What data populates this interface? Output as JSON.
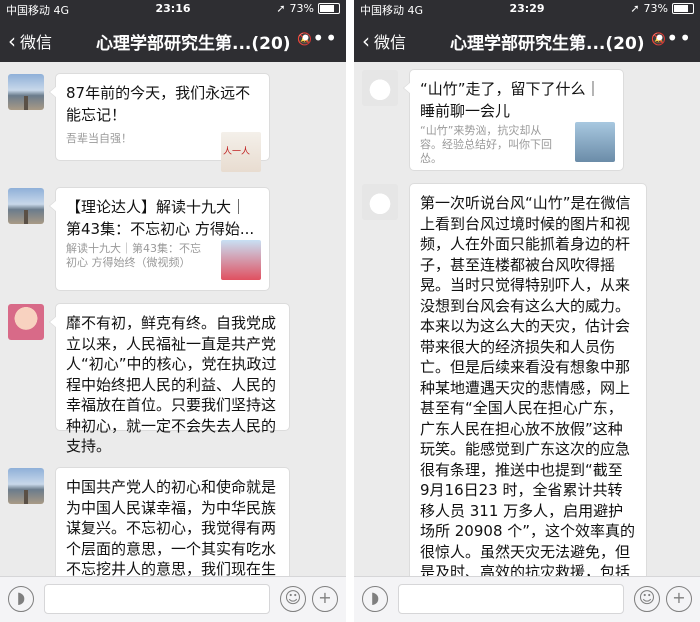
{
  "left": {
    "status": {
      "carrier": "中国移动  4G",
      "time": "23:16",
      "battery": "73%"
    },
    "nav": {
      "back": "微信",
      "title": "心理学部研究生第...(20)"
    },
    "messages": [
      {
        "type": "link",
        "title": "87年前的今天，我们永远不能忘记！",
        "desc": "吾辈当自强！"
      },
      {
        "type": "link",
        "title": "【理论达人】解读十九大｜第43集：不忘初心 方得始...",
        "desc": "解读十九大｜第43集：不忘初心 方得始终（微视频）"
      },
      {
        "type": "text",
        "text": "靡不有初，鲜克有终。自我党成立以来，人民福祉一直是共产党人“初心”中的核心，党在执政过程中始终把人民的利益、人民的幸福放在首位。只要我们坚持这种初心，就一定不会失去人民的支持。"
      },
      {
        "type": "text",
        "text": "中国共产党人的初心和使命就是为中国人民谋幸福，为中华民族谋复兴。不忘初心，我觉得有两个层面的意思，一个其实有吃水不忘挖井人的意思，我们现在生活在和平安稳的时代和环境里"
      }
    ]
  },
  "right": {
    "status": {
      "carrier": "中国移动  4G",
      "time": "23:29",
      "battery": "73%"
    },
    "nav": {
      "back": "微信",
      "title": "心理学部研究生第...(20)"
    },
    "messages": [
      {
        "type": "link",
        "title": "“山竹”走了，留下了什么｜睡前聊一会儿",
        "desc": "“山竹”来势汹，抗灾却从容。经验总结好，叫你下回怂。"
      },
      {
        "type": "text",
        "text": "第一次听说台风“山竹”是在微信上看到台风过境时候的图片和视频，人在外面只能抓着身边的杆子，甚至连楼都被台风吹得摇晃。当时只觉得特别吓人，从来没想到台风会有这么大的威力。本来以为这么大的天灾，估计会带来很大的经济损失和人员伤亡。但是后续来看没有想象中那种某地遭遇天灾的悲情感，网上甚至有“全国人民在担心广东，广东人民在担心放不放假”这种玩笑。能感觉到广东这次的应急很有条理，推送中也提到“截至 9月16日23 时，全省累计共转移人员 311 万多人，启用避护场所 20908 个”，这个效率真的很惊人。虽然天灾无法避免，但是及时、高效的抗灾救援，包括背后体现的信息沟通、统筹能力还是非常让人振奋的，这或许比那些"
      }
    ]
  },
  "icons": [
    "voice-icon",
    "emoji-icon",
    "plus-icon",
    "mute-icon",
    "more-icon",
    "back-chevron-icon"
  ]
}
